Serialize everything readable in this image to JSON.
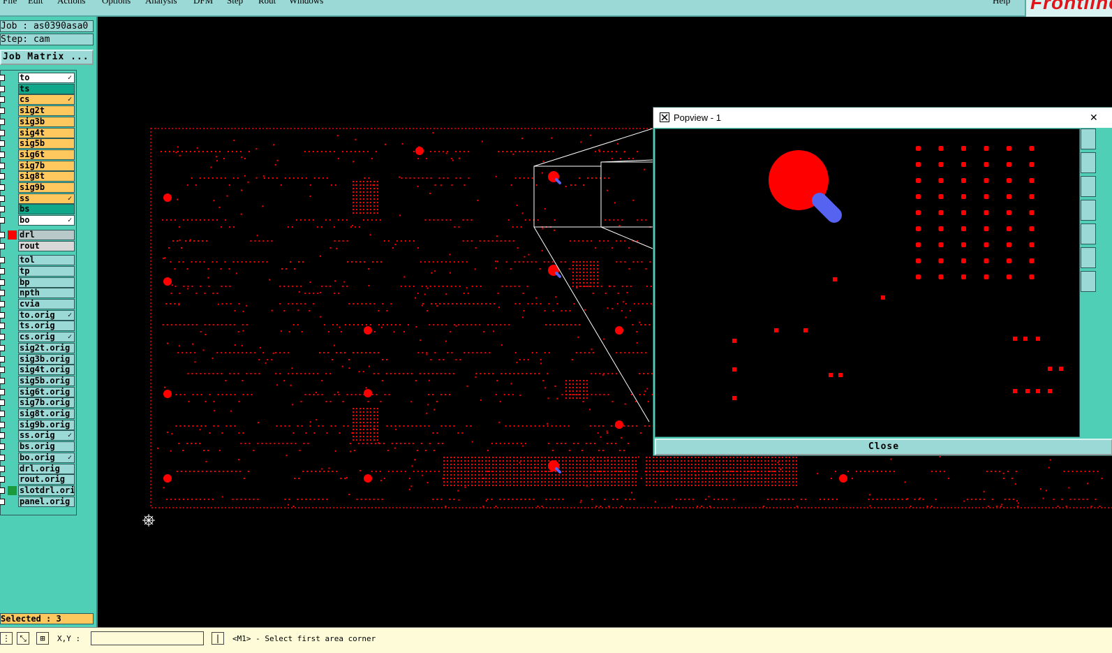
{
  "menu": {
    "items": [
      "File",
      "Edit",
      "Actions",
      "Options",
      "Analysis",
      "DFM",
      "Step",
      "Rout",
      "Windows"
    ],
    "help": "Help",
    "logo": "Frontline"
  },
  "info": {
    "job": "Job : as0390asa0",
    "step": "Step: cam",
    "job_matrix": "Job Matrix ..."
  },
  "layers": [
    {
      "name": "to",
      "color": "#ffffff",
      "mark": "✓"
    },
    {
      "name": "ts",
      "color": "#10a88a",
      "mark": ""
    },
    {
      "name": "cs",
      "color": "#ffc85e",
      "mark": "✓"
    },
    {
      "name": "sig2t",
      "color": "#ffc85e",
      "mark": ""
    },
    {
      "name": "sig3b",
      "color": "#ffc85e",
      "mark": ""
    },
    {
      "name": "sig4t",
      "color": "#ffc85e",
      "mark": ""
    },
    {
      "name": "sig5b",
      "color": "#ffc85e",
      "mark": ""
    },
    {
      "name": "sig6t",
      "color": "#ffc85e",
      "mark": ""
    },
    {
      "name": "sig7b",
      "color": "#ffc85e",
      "mark": ""
    },
    {
      "name": "sig8t",
      "color": "#ffc85e",
      "mark": ""
    },
    {
      "name": "sig9b",
      "color": "#ffc85e",
      "mark": ""
    },
    {
      "name": "ss",
      "color": "#ffc85e",
      "mark": "✓"
    },
    {
      "name": "bs",
      "color": "#10a88a",
      "mark": ""
    },
    {
      "name": "bo",
      "color": "#ffffff",
      "mark": "✓"
    },
    {
      "name": "drl",
      "color": "#b8c8c8",
      "mark": "",
      "swatch": "#ff0000"
    },
    {
      "name": "rout",
      "color": "#d8d8d8",
      "mark": ""
    },
    {
      "name": "tol",
      "color": "#9bd9d6",
      "mark": ""
    },
    {
      "name": "tp",
      "color": "#9bd9d6",
      "mark": ""
    },
    {
      "name": "bp",
      "color": "#9bd9d6",
      "mark": ""
    },
    {
      "name": "npth",
      "color": "#9bd9d6",
      "mark": ""
    },
    {
      "name": "cvia",
      "color": "#9bd9d6",
      "mark": ""
    },
    {
      "name": "to.orig",
      "color": "#9bd9d6",
      "mark": "✓"
    },
    {
      "name": "ts.orig",
      "color": "#9bd9d6",
      "mark": ""
    },
    {
      "name": "cs.orig",
      "color": "#9bd9d6",
      "mark": "✓"
    },
    {
      "name": "sig2t.orig",
      "color": "#9bd9d6",
      "mark": ""
    },
    {
      "name": "sig3b.orig",
      "color": "#9bd9d6",
      "mark": ""
    },
    {
      "name": "sig4t.orig",
      "color": "#9bd9d6",
      "mark": ""
    },
    {
      "name": "sig5b.orig",
      "color": "#9bd9d6",
      "mark": ""
    },
    {
      "name": "sig6t.orig",
      "color": "#9bd9d6",
      "mark": ""
    },
    {
      "name": "sig7b.orig",
      "color": "#9bd9d6",
      "mark": ""
    },
    {
      "name": "sig8t.orig",
      "color": "#9bd9d6",
      "mark": ""
    },
    {
      "name": "sig9b.orig",
      "color": "#9bd9d6",
      "mark": ""
    },
    {
      "name": "ss.orig",
      "color": "#9bd9d6",
      "mark": "✓"
    },
    {
      "name": "bs.orig",
      "color": "#9bd9d6",
      "mark": ""
    },
    {
      "name": "bo.orig",
      "color": "#9bd9d6",
      "mark": "✓"
    },
    {
      "name": "drl.orig",
      "color": "#9bd9d6",
      "mark": ""
    },
    {
      "name": "rout.orig",
      "color": "#9bd9d6",
      "mark": ""
    },
    {
      "name": "slotdrl.orig",
      "color": "#9bd9d6",
      "mark": "",
      "swatch": "#1a9a3a"
    },
    {
      "name": "panel.orig",
      "color": "#9bd9d6",
      "mark": ""
    }
  ],
  "selected": "Selected : 3",
  "status": {
    "coord_label": "X,Y :",
    "message": "<M1> - Select first area corner"
  },
  "popview": {
    "title": "Popview - 1",
    "close_x": "✕",
    "close_button": "Close"
  },
  "colors": {
    "pad": "#ff0000",
    "highlight": "#5563f0",
    "background": "#000000"
  }
}
